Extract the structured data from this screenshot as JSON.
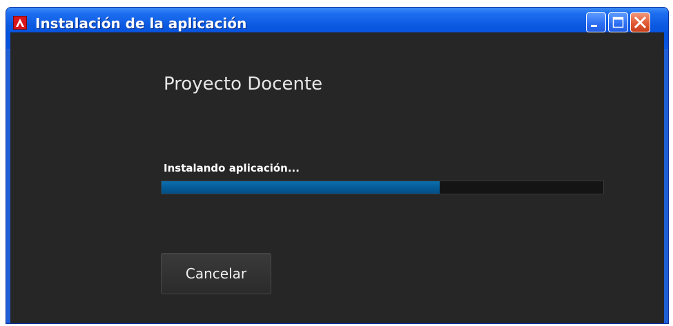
{
  "window": {
    "title": "Instalación de la aplicación",
    "icon": "adobe-air-icon",
    "controls": [
      "minimize-icon",
      "maximize-icon",
      "close-icon"
    ],
    "colors": {
      "titlebar": "#0451dd",
      "content_background": "#262626",
      "close_button": "#e05a33"
    }
  },
  "main": {
    "app_name": "Proyecto Docente",
    "status": "Instalando aplicación...",
    "progress": 0.63,
    "progress_color": "#055c98",
    "cancel_label": "Cancelar"
  }
}
